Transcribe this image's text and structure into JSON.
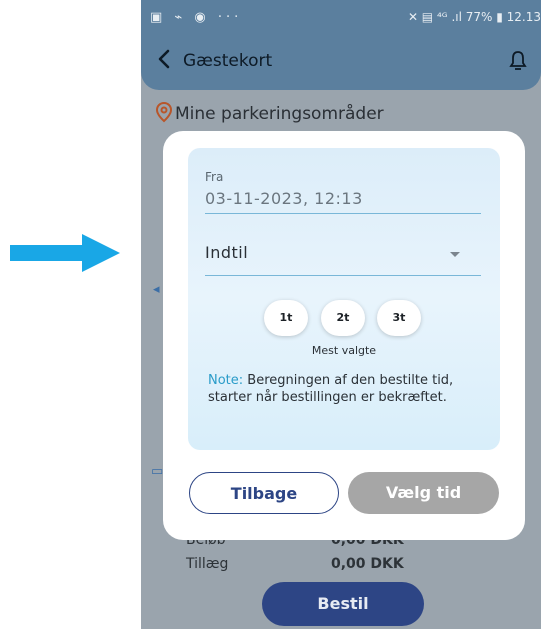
{
  "status_bar": {
    "left_icons": "▣ ⌁ ◉ ···",
    "right_text": "✕ ▤ ⁴ᴳ .ıl 77% ▮ 12.13"
  },
  "header": {
    "title": "Gæstekort",
    "back_icon": "chevron-left-icon",
    "bell_icon": "bell-icon"
  },
  "section": {
    "title": "Mine parkeringsområder",
    "icon": "location-pin-icon"
  },
  "background": {
    "row1_label": "Beløb",
    "row1_value": "0,00 DKK",
    "row2_label": "Tillæg",
    "row2_value": "0,00 DKK",
    "order_button": "Bestil"
  },
  "modal": {
    "from_label": "Fra",
    "from_value": "03-11-2023, 12:13",
    "until_placeholder": "Indtil",
    "chips": [
      "1t",
      "2t",
      "3t"
    ],
    "most_chosen": "Mest valgte",
    "note_label": "Note:",
    "note_text": " Beregningen af den bestilte tid, starter når bestillingen er bekræftet.",
    "back_button": "Tilbage",
    "choose_time_button": "Vælg tid"
  },
  "colors": {
    "arrow": "#19a7e6",
    "header": "#5b7f9e",
    "primary": "#2d4585",
    "note_accent": "#2a9cc9"
  }
}
